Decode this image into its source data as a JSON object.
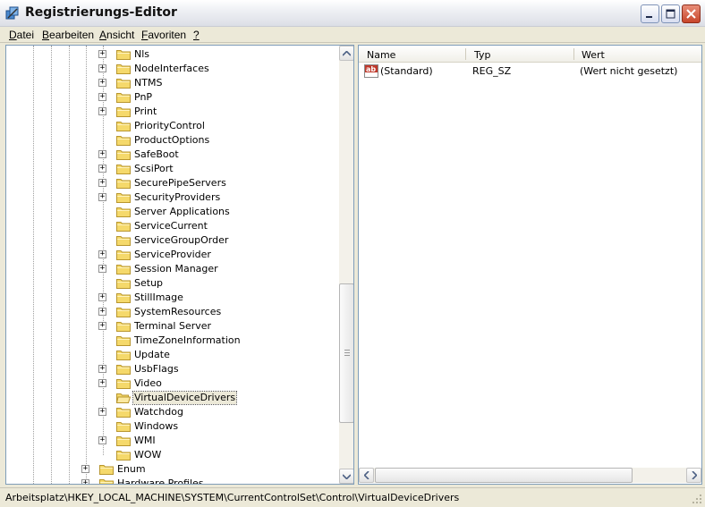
{
  "window": {
    "title": "Registrierungs-Editor",
    "icon": "regedit-icon"
  },
  "menu": [
    {
      "label": "Datei",
      "ul": "D",
      "rest": "atei"
    },
    {
      "label": "Bearbeiten",
      "ul": "B",
      "rest": "earbeiten"
    },
    {
      "label": "Ansicht",
      "ul": "A",
      "rest": "nsicht"
    },
    {
      "label": "Favoriten",
      "ul": "F",
      "rest": "avoriten"
    },
    {
      "label": "?",
      "ul": "?",
      "rest": ""
    }
  ],
  "tree": {
    "items": [
      {
        "label": "Nls",
        "expandable": true
      },
      {
        "label": "NodeInterfaces",
        "expandable": true
      },
      {
        "label": "NTMS",
        "expandable": true
      },
      {
        "label": "PnP",
        "expandable": true
      },
      {
        "label": "Print",
        "expandable": true
      },
      {
        "label": "PriorityControl",
        "expandable": false
      },
      {
        "label": "ProductOptions",
        "expandable": false
      },
      {
        "label": "SafeBoot",
        "expandable": true
      },
      {
        "label": "ScsiPort",
        "expandable": true
      },
      {
        "label": "SecurePipeServers",
        "expandable": true
      },
      {
        "label": "SecurityProviders",
        "expandable": true
      },
      {
        "label": "Server Applications",
        "expandable": false
      },
      {
        "label": "ServiceCurrent",
        "expandable": false
      },
      {
        "label": "ServiceGroupOrder",
        "expandable": false
      },
      {
        "label": "ServiceProvider",
        "expandable": true
      },
      {
        "label": "Session Manager",
        "expandable": true
      },
      {
        "label": "Setup",
        "expandable": false
      },
      {
        "label": "StillImage",
        "expandable": true
      },
      {
        "label": "SystemResources",
        "expandable": true
      },
      {
        "label": "Terminal Server",
        "expandable": true
      },
      {
        "label": "TimeZoneInformation",
        "expandable": false
      },
      {
        "label": "Update",
        "expandable": false
      },
      {
        "label": "UsbFlags",
        "expandable": true
      },
      {
        "label": "Video",
        "expandable": true
      },
      {
        "label": "VirtualDeviceDrivers",
        "expandable": false,
        "selected": true,
        "open": true
      },
      {
        "label": "Watchdog",
        "expandable": true
      },
      {
        "label": "Windows",
        "expandable": false
      },
      {
        "label": "WMI",
        "expandable": true
      },
      {
        "label": "WOW",
        "expandable": false
      }
    ],
    "parent_siblings": [
      {
        "label": "Enum",
        "expandable": true
      },
      {
        "label": "Hardware Profiles",
        "expandable": true
      }
    ]
  },
  "list": {
    "columns": [
      "Name",
      "Typ",
      "Wert"
    ],
    "rows": [
      {
        "name": "(Standard)",
        "type": "REG_SZ",
        "value": "(Wert nicht gesetzt)",
        "icon": "string-value-icon"
      }
    ]
  },
  "status": {
    "path": "Arbeitsplatz\\HKEY_LOCAL_MACHINE\\SYSTEM\\CurrentControlSet\\Control\\VirtualDeviceDrivers"
  },
  "colors": {
    "folder": "#f5d96b",
    "folder_edge": "#b8962e",
    "selection": "#ece9d8",
    "close_button": "#c7452a"
  }
}
